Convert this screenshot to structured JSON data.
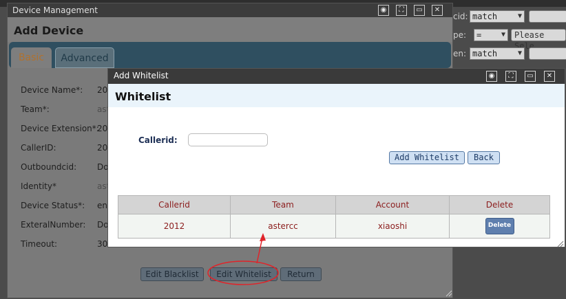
{
  "background": {
    "filters": [
      {
        "label": "cid:",
        "op": "match"
      },
      {
        "label": "pe:",
        "op": "=",
        "input": "Please Sele"
      },
      {
        "label": "en:",
        "op": "match"
      }
    ]
  },
  "device_management": {
    "window_title": "Device Management",
    "heading": "Add Device",
    "tabs": [
      "Basic",
      "Advanced"
    ],
    "fields": [
      {
        "label": "Device Name*:",
        "value": "20"
      },
      {
        "label": "Team*:",
        "value": "ast"
      },
      {
        "label": "Device Extension*:",
        "value": "20"
      },
      {
        "label": "CallerID:",
        "value": "20"
      },
      {
        "label": "Outboundcid:",
        "value": "Do"
      },
      {
        "label": "Identity*",
        "value": "ast"
      },
      {
        "label": "Device Status*:",
        "value": "en"
      },
      {
        "label": "ExteralNumber:",
        "value": "Do"
      },
      {
        "label": "Timeout:",
        "value": "30"
      }
    ],
    "buttons": {
      "blacklist": "Edit Blacklist",
      "whitelist": "Edit Whitelist",
      "return": "Return"
    }
  },
  "whitelist_dialog": {
    "window_title": "Add Whitelist",
    "heading": "Whitelist",
    "callerid_label": "Callerid:",
    "callerid_value": "",
    "add_button": "Add Whitelist",
    "back_button": "Back",
    "table": {
      "headers": [
        "Callerid",
        "Team",
        "Account",
        "Delete"
      ],
      "rows": [
        {
          "callerid": "2012",
          "team": "astercc",
          "account": "xiaoshi",
          "action": "Delete"
        }
      ]
    }
  },
  "colors": {
    "accent_red": "#e0242a",
    "dialog_header": "#eaf4fb",
    "table_text": "#8b1c1c"
  }
}
